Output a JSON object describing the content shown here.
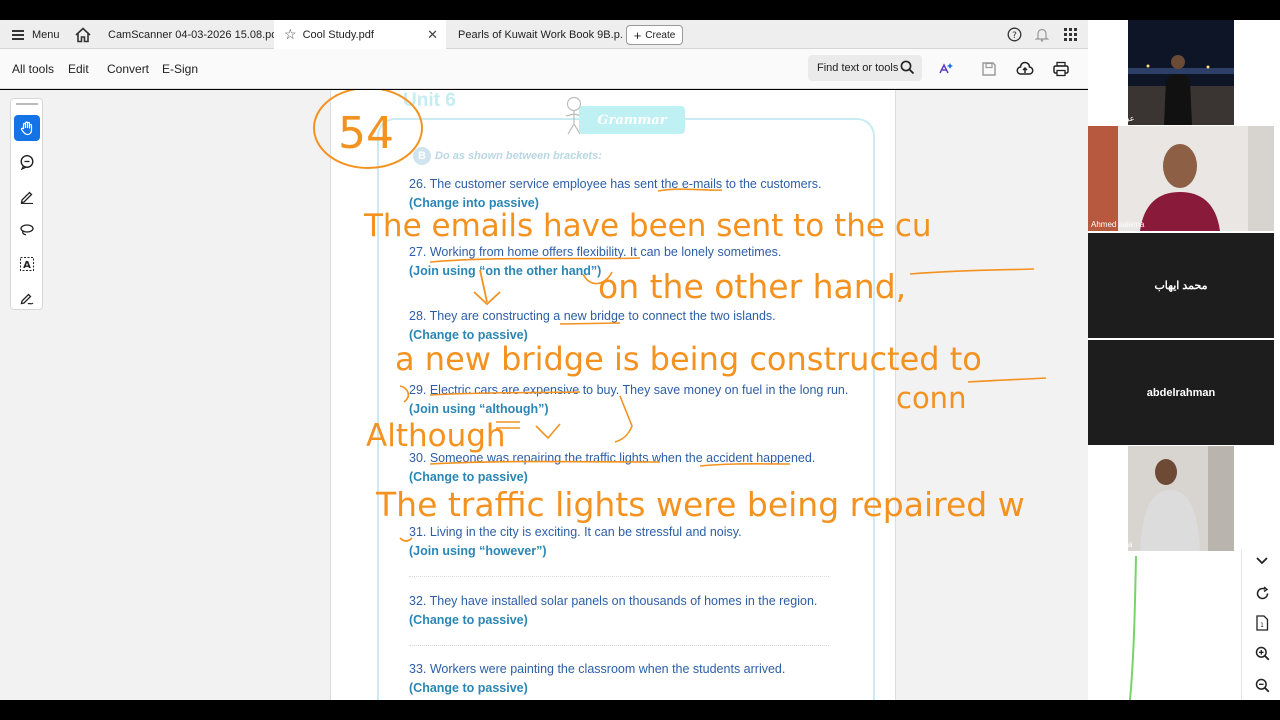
{
  "tabs": {
    "menu_label": "Menu",
    "items": [
      {
        "label": "CamScanner 04-03-2026 15.08.pdf"
      },
      {
        "label": "Cool Study.pdf"
      },
      {
        "label": "Pearls of Kuwait Work Book 9B.p..."
      }
    ],
    "create_label": "Create"
  },
  "toolbar": {
    "all_tools": "All tools",
    "edit": "Edit",
    "convert": "Convert",
    "esign": "E-Sign",
    "find_placeholder": "Find text or tools"
  },
  "document": {
    "unit": "Unit 6",
    "section_letter": "B",
    "section_title": "Do as shown between brackets:",
    "grammar_label": "Grammar",
    "questions": [
      {
        "text": "26. The customer service employee has sent the e-mails to the customers.",
        "instruction": "(Change into passive)"
      },
      {
        "text": "27. Working from home offers flexibility. It can be lonely sometimes.",
        "instruction": "(Join using “on the other hand”)"
      },
      {
        "text": "28. They are constructing a new bridge to connect the two islands.",
        "instruction": "(Change to passive)"
      },
      {
        "text": "29. Electric cars are expensive to buy. They save money on fuel in the long run.",
        "instruction": "(Join using “although”)"
      },
      {
        "text": "30. Someone was repairing the traffic lights when the accident happened.",
        "instruction": "(Change to passive)"
      },
      {
        "text": "31. Living in the city is exciting. It can be stressful and noisy.",
        "instruction": "(Join using “however”)"
      },
      {
        "text": "32. They have installed solar panels on thousands of homes in the region.",
        "instruction": "(Change to passive)"
      },
      {
        "text": "33. Workers were painting the classroom when the students arrived.",
        "instruction": "(Change to passive)"
      }
    ]
  },
  "annotations": {
    "page_number": "54",
    "lines": [
      "The emails have been sent to the cu",
      "on the other hand,",
      "a new bridge is being constructed to",
      "conn",
      "Although",
      "The traffic lights were being repaired w"
    ]
  },
  "participants": [
    {
      "name": "عبدالله محمد"
    },
    {
      "name": "Ahmed salama"
    },
    {
      "name": "محمد ايهاب"
    },
    {
      "name": "abdelrahman"
    },
    {
      "name": "Ali Hamada"
    }
  ],
  "colors": {
    "accent": "#1473e6",
    "ink": "#f49220",
    "doc_text": "#2c5ea7",
    "instruction": "#2a86b4"
  }
}
